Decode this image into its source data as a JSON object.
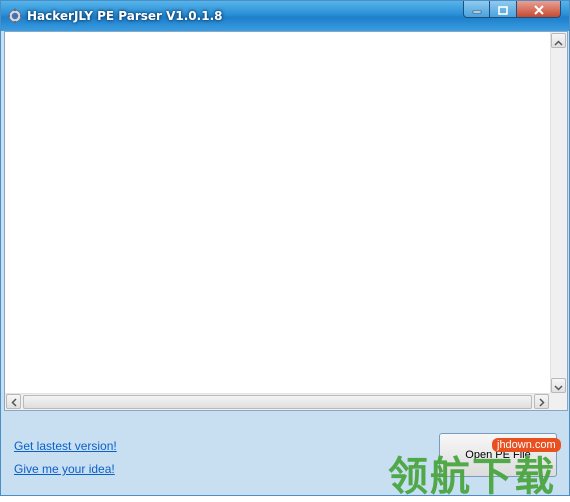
{
  "window": {
    "title": "HackerJLY PE Parser V1.0.1.8"
  },
  "controls": {
    "minimize_icon": "minimize-icon",
    "maximize_icon": "maximize-icon",
    "close_icon": "close-icon"
  },
  "content": {
    "text": ""
  },
  "links": {
    "latest_version": "Get lastest version!",
    "idea": "Give me your idea!"
  },
  "buttons": {
    "open_pe_file": "Open PE File"
  },
  "watermark": {
    "site": "jhdown.com",
    "chinese": "领航下载"
  },
  "colors": {
    "title_bar": "#2a8fd6",
    "window_bg": "#c8dff2",
    "link": "#0b5fc9",
    "close_button": "#c74a32"
  }
}
